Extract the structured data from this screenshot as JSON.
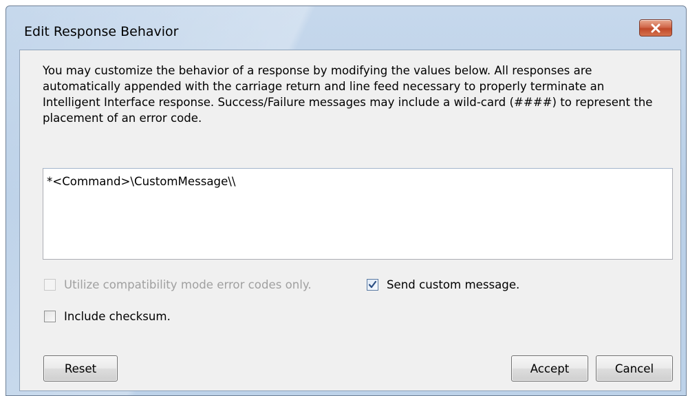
{
  "window": {
    "title": "Edit Response Behavior"
  },
  "description": "You may customize the behavior of a response by modifying the values below. All responses are automatically appended with the carriage return and line feed necessary to properly terminate an Intelligent Interface response. Success/Failure messages may include a wild-card (####) to represent the placement of an error code.",
  "message": {
    "value": "*<Command>\\CustomMessage\\\\"
  },
  "options": {
    "compatibility": {
      "label": "Utilize compatibility mode error codes only.",
      "checked": false,
      "enabled": false
    },
    "send_custom": {
      "label": "Send custom message.",
      "checked": true,
      "enabled": true
    },
    "checksum": {
      "label": "Include checksum.",
      "checked": false,
      "enabled": true
    }
  },
  "buttons": {
    "reset": "Reset",
    "accept": "Accept",
    "cancel": "Cancel"
  },
  "icons": {
    "close": "close-icon",
    "check": "checkmark-icon"
  },
  "colors": {
    "frame": "#bdd2e9",
    "close_button": "#c8563a",
    "client": "#f0f0f0"
  }
}
